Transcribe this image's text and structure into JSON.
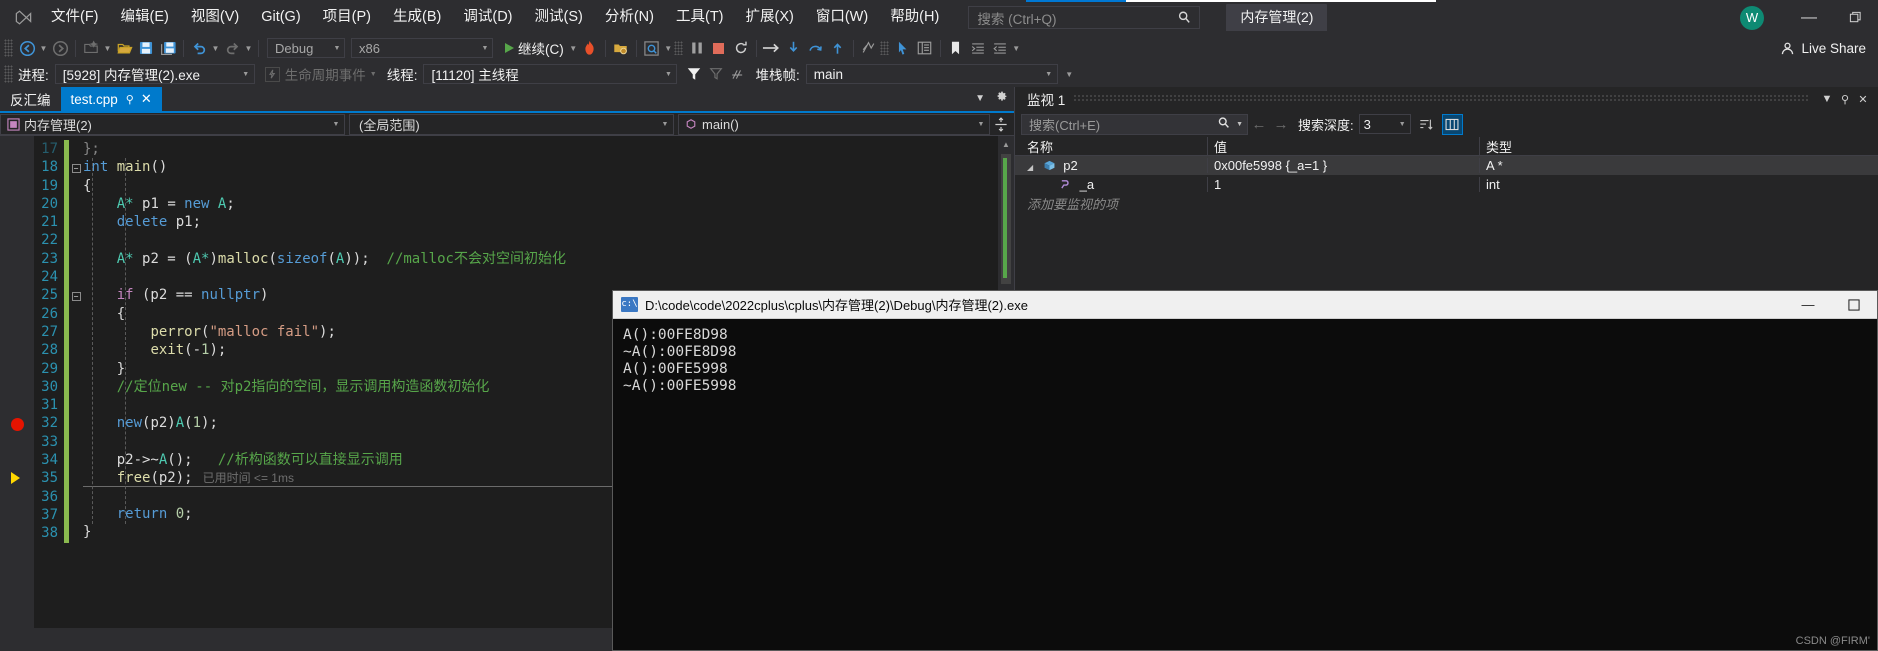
{
  "window": {
    "title_tab": "内存管理(2)",
    "avatar_initial": "W"
  },
  "menubar": {
    "logo": "vs-logo-icon",
    "items": [
      {
        "label": "文件(F)"
      },
      {
        "label": "编辑(E)"
      },
      {
        "label": "视图(V)"
      },
      {
        "label": "Git(G)"
      },
      {
        "label": "项目(P)"
      },
      {
        "label": "生成(B)"
      },
      {
        "label": "调试(D)"
      },
      {
        "label": "测试(S)"
      },
      {
        "label": "分析(N)"
      },
      {
        "label": "工具(T)"
      },
      {
        "label": "扩展(X)"
      },
      {
        "label": "窗口(W)"
      },
      {
        "label": "帮助(H)"
      }
    ],
    "search_placeholder": "搜索 (Ctrl+Q)",
    "minimize": "—",
    "restore": "❐"
  },
  "toolbar": {
    "config": "Debug",
    "platform": "x86",
    "continue_label": "继续(C)",
    "live_share": "Live Share"
  },
  "debugbar": {
    "process_label": "进程:",
    "process_value": "[5928] 内存管理(2).exe",
    "lifecycle_label": "生命周期事件",
    "thread_label": "线程:",
    "thread_value": "[11120] 主线程",
    "stackframe_label": "堆栈帧:",
    "stackframe_value": "main"
  },
  "editor": {
    "tabs": [
      {
        "label": "反汇编",
        "active": false,
        "closable": false
      },
      {
        "label": "test.cpp",
        "active": true,
        "closable": true
      }
    ],
    "nav": {
      "project": "内存管理(2)",
      "scope": "(全局范围)",
      "member": "main()"
    },
    "elapsed_note": "已用时间 <= 1ms",
    "lines": [
      {
        "n": 17,
        "clipped": true,
        "tokens": [
          {
            "t": "};",
            "c": "pl"
          }
        ]
      },
      {
        "n": 18,
        "fold": "minus",
        "tokens": [
          {
            "t": "int",
            "c": "kw"
          },
          {
            "t": " ",
            "c": "pl"
          },
          {
            "t": "main",
            "c": "fn"
          },
          {
            "t": "()",
            "c": "pl"
          }
        ]
      },
      {
        "n": 19,
        "tokens": [
          {
            "t": "{",
            "c": "pl"
          }
        ]
      },
      {
        "n": 20,
        "tokens": [
          {
            "t": "    A* ",
            "c": "typ"
          },
          {
            "t": "p1 ",
            "c": "pl"
          },
          {
            "t": "= ",
            "c": "pl"
          },
          {
            "t": "new",
            "c": "kw"
          },
          {
            "t": " ",
            "c": "pl"
          },
          {
            "t": "A",
            "c": "typ"
          },
          {
            "t": ";",
            "c": "pl"
          }
        ]
      },
      {
        "n": 21,
        "tokens": [
          {
            "t": "    ",
            "c": "pl"
          },
          {
            "t": "delete",
            "c": "kw"
          },
          {
            "t": " p1;",
            "c": "pl"
          }
        ]
      },
      {
        "n": 22,
        "tokens": []
      },
      {
        "n": 23,
        "tokens": [
          {
            "t": "    A* ",
            "c": "typ"
          },
          {
            "t": "p2 = (",
            "c": "pl"
          },
          {
            "t": "A*",
            "c": "typ"
          },
          {
            "t": ")",
            "c": "pl"
          },
          {
            "t": "malloc",
            "c": "fn"
          },
          {
            "t": "(",
            "c": "pl"
          },
          {
            "t": "sizeof",
            "c": "kw"
          },
          {
            "t": "(",
            "c": "pl"
          },
          {
            "t": "A",
            "c": "typ"
          },
          {
            "t": "));  ",
            "c": "pl"
          },
          {
            "t": "//malloc不会对空间初始化",
            "c": "cmt"
          }
        ]
      },
      {
        "n": 24,
        "tokens": []
      },
      {
        "n": 25,
        "fold": "minus",
        "tokens": [
          {
            "t": "    ",
            "c": "pl"
          },
          {
            "t": "if",
            "c": "macro"
          },
          {
            "t": " (p2 ",
            "c": "pl"
          },
          {
            "t": "==",
            "c": "pl"
          },
          {
            "t": " ",
            "c": "pl"
          },
          {
            "t": "nullptr",
            "c": "kw"
          },
          {
            "t": ")",
            "c": "pl"
          }
        ]
      },
      {
        "n": 26,
        "tokens": [
          {
            "t": "    {",
            "c": "pl"
          }
        ]
      },
      {
        "n": 27,
        "tokens": [
          {
            "t": "        ",
            "c": "pl"
          },
          {
            "t": "perror",
            "c": "fn"
          },
          {
            "t": "(",
            "c": "pl"
          },
          {
            "t": "\"malloc fail\"",
            "c": "str"
          },
          {
            "t": ");",
            "c": "pl"
          }
        ]
      },
      {
        "n": 28,
        "tokens": [
          {
            "t": "        ",
            "c": "pl"
          },
          {
            "t": "exit",
            "c": "fn"
          },
          {
            "t": "(-",
            "c": "pl"
          },
          {
            "t": "1",
            "c": "num"
          },
          {
            "t": ");",
            "c": "pl"
          }
        ]
      },
      {
        "n": 29,
        "tokens": [
          {
            "t": "    }",
            "c": "pl"
          }
        ]
      },
      {
        "n": 30,
        "tokens": [
          {
            "t": "    //定位new -- 对p2指向的空间，显示调用构造函数初始化",
            "c": "cmt"
          }
        ]
      },
      {
        "n": 31,
        "tokens": []
      },
      {
        "n": 32,
        "breakpoint": true,
        "tokens": [
          {
            "t": "    ",
            "c": "pl"
          },
          {
            "t": "new",
            "c": "kw"
          },
          {
            "t": "(p2)",
            "c": "pl"
          },
          {
            "t": "A",
            "c": "typ"
          },
          {
            "t": "(",
            "c": "pl"
          },
          {
            "t": "1",
            "c": "num"
          },
          {
            "t": ");",
            "c": "pl"
          }
        ]
      },
      {
        "n": 33,
        "tokens": []
      },
      {
        "n": 34,
        "tokens": [
          {
            "t": "    p2->~",
            "c": "pl"
          },
          {
            "t": "A",
            "c": "typ"
          },
          {
            "t": "();   ",
            "c": "pl"
          },
          {
            "t": "//析构函数可以直接显示调用",
            "c": "cmt"
          }
        ]
      },
      {
        "n": 35,
        "current": true,
        "tokens": [
          {
            "t": "    ",
            "c": "pl"
          },
          {
            "t": "free",
            "c": "fn"
          },
          {
            "t": "(p2);",
            "c": "pl"
          }
        ]
      },
      {
        "n": 36,
        "tokens": []
      },
      {
        "n": 37,
        "tokens": [
          {
            "t": "    ",
            "c": "pl"
          },
          {
            "t": "return",
            "c": "kw"
          },
          {
            "t": " ",
            "c": "pl"
          },
          {
            "t": "0",
            "c": "num"
          },
          {
            "t": ";",
            "c": "pl"
          }
        ]
      },
      {
        "n": 38,
        "tokens": [
          {
            "t": "}",
            "c": "pl"
          }
        ]
      }
    ]
  },
  "watch": {
    "title": "监视 1",
    "search_placeholder": "搜索(Ctrl+E)",
    "depth_label": "搜索深度:",
    "depth_value": "3",
    "columns": [
      "名称",
      "值",
      "类型"
    ],
    "rows": [
      {
        "name": "p2",
        "value": "0x00fe5998 {_a=1 }",
        "type": "A *",
        "indent": 0,
        "expander": "▲",
        "icon": "cube-icon",
        "selected": true
      },
      {
        "name": "_a",
        "value": "1",
        "type": "int",
        "indent": 1,
        "expander": "",
        "icon": "field-icon",
        "selected": false
      }
    ],
    "add_item_placeholder": "添加要监视的项"
  },
  "console": {
    "path": "D:\\code\\code\\2022cplus\\cplus\\内存管理(2)\\Debug\\内存管理(2).exe",
    "icon": "console-icon",
    "minimize": "—",
    "maximize": "☐",
    "lines": [
      "A():00FE8D98",
      "~A():00FE8D98",
      "A():00FE5998",
      "~A():00FE5998"
    ]
  },
  "watermark": "CSDN @FIRM'",
  "colors": {
    "accent": "#007acc",
    "breakpoint": "#e51400",
    "current_line_arrow": "#ffd700",
    "console_bg": "#0c0c0c",
    "editor_bg": "#1e1e1e",
    "chrome_bg": "#2d2d30"
  }
}
